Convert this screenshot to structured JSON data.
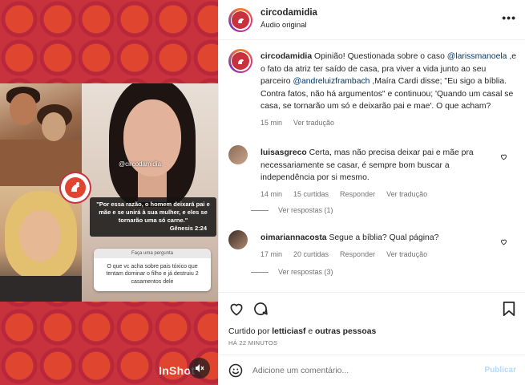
{
  "media": {
    "handle_tag": "@circodamidia",
    "quote_text": "\"Por essa razão, o homem deixará pai e mãe e se unirá à sua mulher, e eles se tornarão uma só carne.\"",
    "quote_ref": "Gênesis 2:24",
    "qa_header": "Faça uma pergunta",
    "qa_text": "O que vc acha sobre pais tóxico que tentam dominar o filho e já destruiu 2 casamentos dele",
    "watermark": "InShot",
    "colors": {
      "pattern_bg": "#c8323c",
      "pattern_circle": "#e0452f"
    }
  },
  "header": {
    "username": "circodamidia",
    "subtitle": "Áudio original",
    "more_icon": "more-horizontal-icon"
  },
  "caption": {
    "username": "circodamidia",
    "text_1": " Opinião! Questionada sobre o caso ",
    "mention_1": "@larissmanoela",
    "text_2": " ,e o fato da atriz ter saído de casa, pra viver a vida junto ao seu parceiro ",
    "mention_2": "@andreluizframbach",
    "text_3": " ,Maíra Cardi disse; \"Eu sigo a bíblia. Contra fatos, não há argumentos\" e continuou; 'Quando um casal se casa, se tornarão um só e deixarão pai e mae'. O que acham?",
    "time": "15 min",
    "see_translation": "Ver tradução"
  },
  "comments": [
    {
      "username": "luisasgreco",
      "text": " Certa, mas não precisa deixar pai e mãe pra necessariamente se casar, é sempre bom buscar a independência por si mesmo.",
      "time": "14 min",
      "likes": "15 curtidas",
      "reply": "Responder",
      "see_translation": "Ver tradução",
      "view_replies": "Ver respostas (1)"
    },
    {
      "username": "oimariannacosta",
      "text": " Segue a bíblia? Qual página?",
      "time": "17 min",
      "likes": "20 curtidas",
      "reply": "Responder",
      "see_translation": "Ver tradução",
      "view_replies": "Ver respostas (3)"
    }
  ],
  "footer": {
    "liked_by_prefix": "Curtido por ",
    "liked_by_user": "letticiasf",
    "liked_by_suffix": " e ",
    "liked_by_others": "outras pessoas",
    "time_ago": "HÁ 22 MINUTOS",
    "comment_placeholder": "Adicione um comentário...",
    "post_label": "Publicar",
    "accent_disabled": "#b3dbff"
  }
}
